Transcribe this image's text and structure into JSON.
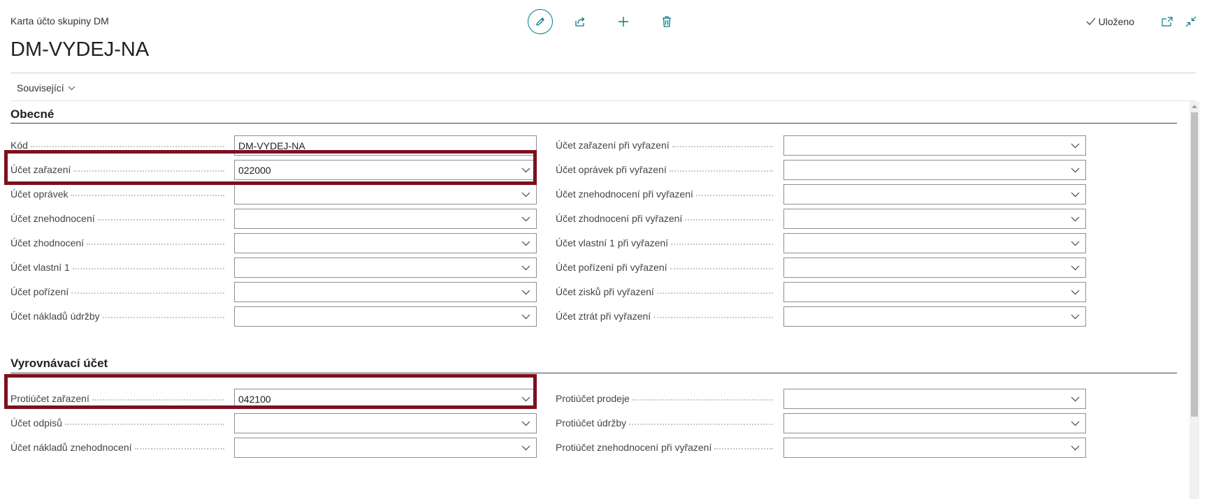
{
  "header": {
    "caption": "Karta účto skupiny DM",
    "title": "DM-VYDEJ-NA",
    "saved_label": "Uloženo"
  },
  "toolbar": {
    "icons": [
      "edit-pencil-icon",
      "share-icon",
      "plus-icon",
      "trash-icon"
    ]
  },
  "menu": {
    "related_label": "Související"
  },
  "colors": {
    "accent": "#007a8a",
    "highlight": "#7a1120"
  },
  "sections": {
    "general": {
      "title": "Obecné",
      "left": [
        {
          "label": "Kód",
          "value": "DM-VYDEJ-NA"
        },
        {
          "label": "Účet zařazení",
          "value": "022000"
        },
        {
          "label": "Účet oprávek",
          "value": ""
        },
        {
          "label": "Účet znehodnocení",
          "value": ""
        },
        {
          "label": "Účet zhodnocení",
          "value": ""
        },
        {
          "label": "Účet vlastní 1",
          "value": ""
        },
        {
          "label": "Účet pořízení",
          "value": ""
        },
        {
          "label": "Účet nákladů údržby",
          "value": ""
        }
      ],
      "right": [
        {
          "label": "Účet zařazení při vyřazení",
          "value": ""
        },
        {
          "label": "Účet oprávek při vyřazení",
          "value": ""
        },
        {
          "label": "Účet znehodnocení při vyřazení",
          "value": ""
        },
        {
          "label": "Účet zhodnocení při vyřazení",
          "value": ""
        },
        {
          "label": "Účet vlastní 1 při vyřazení",
          "value": ""
        },
        {
          "label": "Účet pořízení při vyřazení",
          "value": ""
        },
        {
          "label": "Účet zisků při vyřazení",
          "value": ""
        },
        {
          "label": "Účet ztrát při vyřazení",
          "value": ""
        }
      ]
    },
    "balancing": {
      "title": "Vyrovnávací účet",
      "left": [
        {
          "label": "Protiúčet zařazení",
          "value": "042100"
        },
        {
          "label": "Účet odpisů",
          "value": ""
        },
        {
          "label": "Účet nákladů znehodnocení",
          "value": ""
        }
      ],
      "right": [
        {
          "label": "Protiúčet prodeje",
          "value": ""
        },
        {
          "label": "Protiúčet údržby",
          "value": ""
        },
        {
          "label": "Protiúčet znehodnocení při vyřazení",
          "value": ""
        }
      ]
    }
  }
}
